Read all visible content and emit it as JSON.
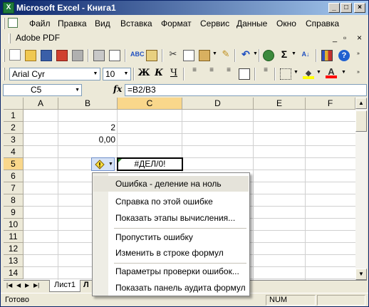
{
  "window": {
    "title": "Microsoft Excel - Книга1",
    "app_icon": "excel-icon"
  },
  "menubar": {
    "items": [
      "Файл",
      "Правка",
      "Вид",
      "Вставка",
      "Формат",
      "Сервис",
      "Данные",
      "Окно",
      "Справка"
    ],
    "adobe": "Adobe PDF"
  },
  "format_toolbar": {
    "font": "Arial Cyr",
    "size": "10",
    "bold": "Ж",
    "italic": "К",
    "underline": "Ч",
    "font_color_label": "А"
  },
  "formula_bar": {
    "name_box": "C5",
    "fx": "fx",
    "formula": "=B2/B3"
  },
  "grid": {
    "columns": [
      "A",
      "B",
      "C",
      "D",
      "E",
      "F"
    ],
    "rows": [
      "1",
      "2",
      "3",
      "4",
      "5",
      "6",
      "7",
      "8",
      "9",
      "10",
      "11",
      "12",
      "13",
      "14"
    ],
    "cells": {
      "B2": "2",
      "B3": "0,00",
      "C5": "#ДЕЛ/0!"
    },
    "active_cell": "C5"
  },
  "sheet_tabs": {
    "active": "Лист1",
    "partial": "Л"
  },
  "statusbar": {
    "left": "Готово",
    "num": "NUM"
  },
  "error_menu": {
    "header": "Ошибка  - деление на ноль",
    "items": [
      "Справка по этой ошибке",
      "Показать этапы вычисления...",
      "Пропустить ошибку",
      "Изменить в строке формул",
      "Параметры проверки ошибок...",
      "Показать панель аудита формул"
    ]
  },
  "colors": {
    "title_start": "#0A246A",
    "title_end": "#A6CAF0",
    "chrome": "#ECE9D8",
    "selected_header": "#F9D78B"
  }
}
